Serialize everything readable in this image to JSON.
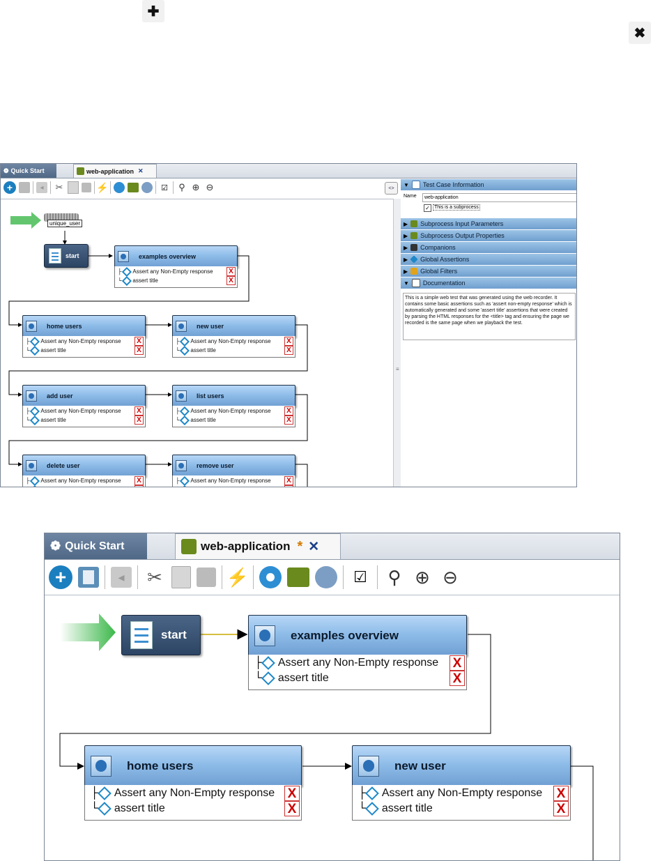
{
  "top_controls": {
    "add_symbol": "✚",
    "close_symbol": "✖"
  },
  "tabs": {
    "quick_start": "Quick Start",
    "web_application": "web-application",
    "modified_marker": "*",
    "close": "✕"
  },
  "toolbar": {
    "items": [
      "add",
      "delete",
      "back",
      "cut",
      "copy",
      "paste",
      "run",
      "configure",
      "export",
      "refresh",
      "checklist",
      "zoom",
      "zoom-in",
      "zoom-out"
    ]
  },
  "flow": {
    "variable_label": "unique_user",
    "start_label": "start",
    "nodes": [
      {
        "title": "examples overview"
      },
      {
        "title": "home users"
      },
      {
        "title": "new user"
      },
      {
        "title": "add user"
      },
      {
        "title": "list users"
      },
      {
        "title": "delete user"
      },
      {
        "title": "remove user"
      }
    ],
    "assertion_1": "Assert any Non-Empty response",
    "assertion_2": "assert title",
    "remove_marker": "X"
  },
  "side_panel": {
    "toggle_label": "<>",
    "sections": {
      "test_case_information": "Test Case Information",
      "subprocess_input": "Subprocess Input Parameters",
      "subprocess_output": "Subprocess Output Properties",
      "companions": "Companions",
      "global_assertions": "Global Assertions",
      "global_filters": "Global Filters",
      "documentation": "Documentation"
    },
    "name_label": "Name",
    "name_value": "web-application",
    "subprocess_checkbox": "This is a subprocess",
    "documentation_text": "This is a simple web test that was generated using the web recorder. It contains some basic assertions such as 'assert non-empty response' which is automatically generated and some 'assert title' assertions that were created by parsing the HTML responses for the <title> tag and ensuring the page we recorded is the same page when we playback the test."
  },
  "colors": {
    "accent": "#6f9fd3",
    "tab_inactive": "#5a7392",
    "start_arrow": "#3cb84a"
  }
}
